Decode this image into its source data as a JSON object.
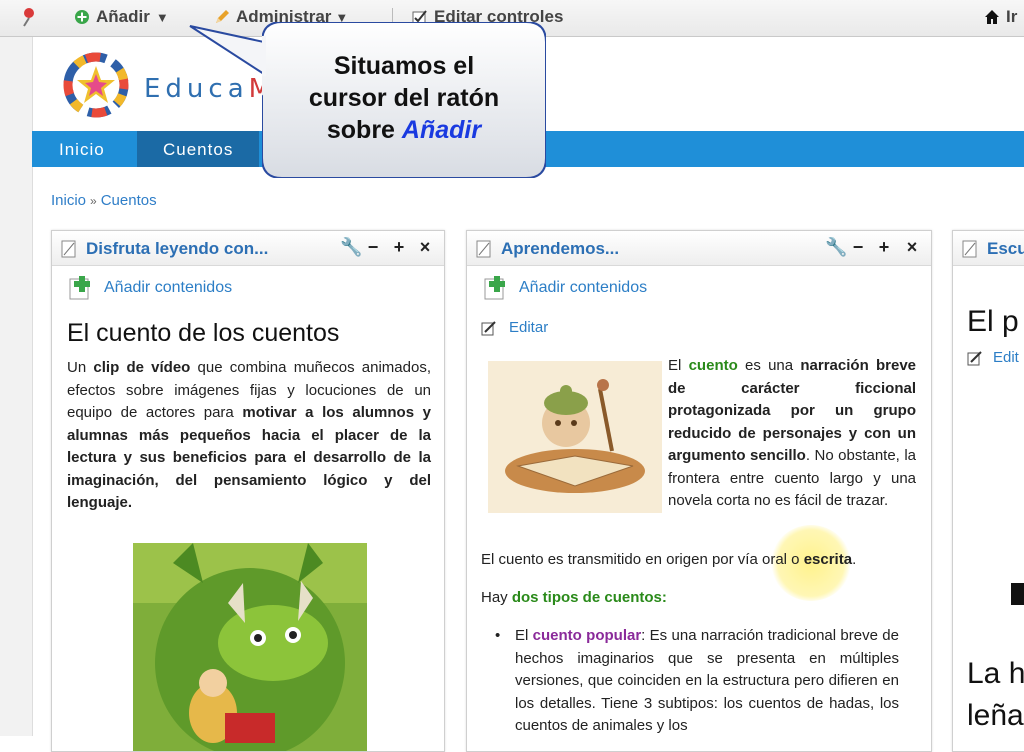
{
  "toolbar": {
    "add_label": "Añadir",
    "admin_label": "Administrar",
    "edit_controls_label": "Editar controles",
    "home_label": "Ir"
  },
  "header": {
    "brand_first": "Educa",
    "brand_accent": "M"
  },
  "nav": {
    "tabs": [
      "Inicio",
      "Cuentos"
    ]
  },
  "breadcrumb": {
    "items": [
      "Inicio",
      "Cuentos"
    ],
    "separator": "»"
  },
  "callout": {
    "line1": "Situamos el",
    "line2": "cursor del ratón",
    "line3_prefix": "sobre",
    "line3_highlight": "Añadir"
  },
  "portlets": [
    {
      "title": "Disfruta leyendo con...",
      "add_contents": "Añadir contenidos",
      "heading": "El cuento de los cuentos",
      "p1_a": "Un ",
      "p1_b": "clip de vídeo",
      "p1_c": " que combina muñecos animados, efectos sobre imágenes fijas y locuciones de un equipo de actores para ",
      "p1_d": "motivar a los alumnos y alumnas más pequeños hacia el placer de la lectura y sus beneficios para el desarrollo de la imaginación, del pensamiento lógico y del lenguaje."
    },
    {
      "title": "Aprendemos...",
      "add_contents": "Añadir contenidos",
      "edit": "Editar",
      "intro_a": "El ",
      "intro_cuento": "cuento",
      "intro_b": " es una ",
      "intro_c": "narración breve de carácter ficcional protagonizada por un grupo reducido de personajes y con un argumento sencillo",
      "intro_d": ". No obstante, la frontera entre cuento largo y una novela corta no es fácil de trazar.",
      "trans_a": "El cuento es transmitido en origen por vía oral o ",
      "trans_b": "escrita",
      "trans_c": ".",
      "tipos_a": "Hay ",
      "tipos_b": "dos tipos de cuentos:",
      "bullet_a": "El ",
      "bullet_b": "cuento popular",
      "bullet_c": ": Es una narración tradicional breve de hechos imaginarios que se presenta en múltiples versiones, que coinciden en la estructura pero difieren en los detalles. Tiene 3 subtipos: los cuentos de hadas, los cuentos de animales y los"
    },
    {
      "title": "Escu",
      "heading": "El p",
      "edit": "Edit",
      "heading2a": "La h",
      "heading2b": "leña"
    }
  ],
  "colors": {
    "nav_blue": "#1f8fd8",
    "nav_active": "#1b6aa5",
    "link_blue": "#2c7ec6",
    "highlight_blue": "#1a3ae0"
  }
}
